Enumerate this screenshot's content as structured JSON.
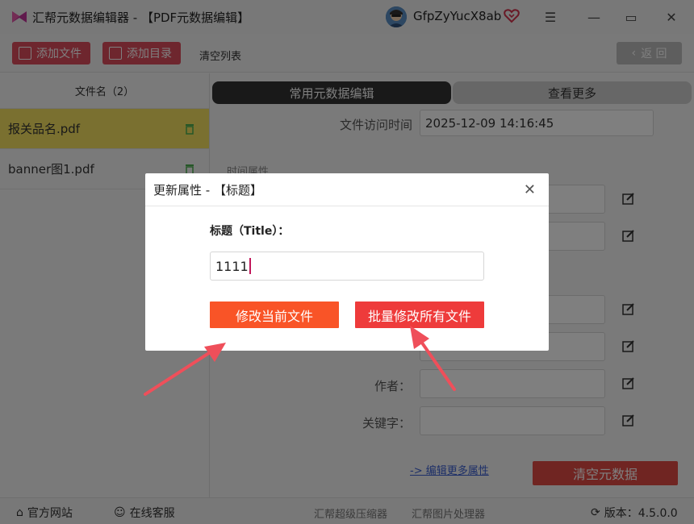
{
  "window": {
    "title": "汇帮元数据编辑器 - 【PDF元数据编辑】",
    "username": "GfpZyYucX8ab",
    "accent": "#dc4d5d"
  },
  "toolbar": {
    "add_file": "添加文件",
    "add_folder": "添加目录",
    "clear_list": "清空列表",
    "back": "返 回"
  },
  "sidebar": {
    "header": "文件名（2）",
    "files": [
      "报关品名.pdf",
      "banner图1.pdf"
    ]
  },
  "main": {
    "tab_common": "常用元数据编辑",
    "tab_more": "查看更多",
    "access_time_label": "文件访问时间",
    "access_time_value": "2025-12-09 14:16:45",
    "section_time": "时间属性",
    "author_label": "作者：",
    "keywords_label": "关键字：",
    "more_link": "-> 编辑更多属性",
    "clear_button": "清空元数据"
  },
  "statusbar": {
    "website": "官方网站",
    "support": "在线客服",
    "compressor": "汇帮超级压缩器",
    "image_tool": "汇帮图片处理器",
    "version": "版本：4.5.0.0"
  },
  "dialog": {
    "title": "更新属性 - 【标题】",
    "field_label": "标题（Title）：",
    "field_value": "1111",
    "btn_current": "修改当前文件",
    "btn_all": "批量修改所有文件"
  }
}
